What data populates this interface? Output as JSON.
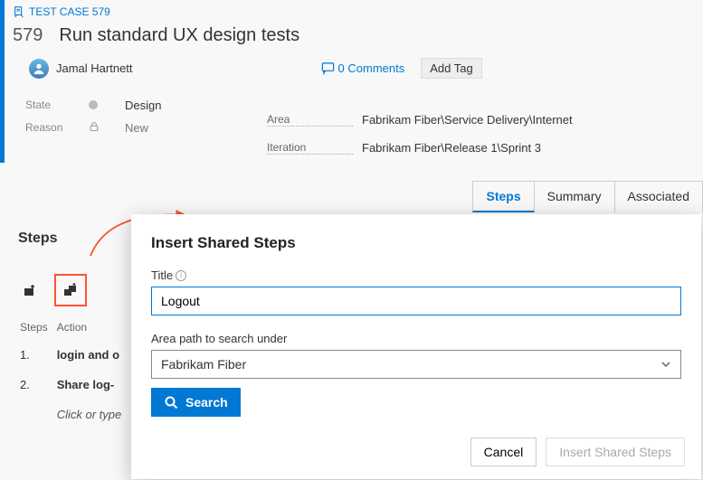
{
  "breadcrumb": {
    "label": "TEST CASE 579"
  },
  "item": {
    "id": "579",
    "title": "Run standard UX design tests"
  },
  "owner": {
    "name": "Jamal Hartnett"
  },
  "comments": {
    "label": "0 Comments"
  },
  "add_tag": {
    "label": "Add Tag"
  },
  "meta": {
    "state_label": "State",
    "state_value": "Design",
    "reason_label": "Reason",
    "reason_value": "New",
    "area_label": "Area",
    "area_value": "Fabrikam Fiber\\Service Delivery\\Internet",
    "iteration_label": "Iteration",
    "iteration_value": "Fabrikam Fiber\\Release 1\\Sprint 3"
  },
  "tabs": {
    "steps": "Steps",
    "summary": "Summary",
    "associated": "Associated"
  },
  "steps": {
    "heading": "Steps",
    "col_steps": "Steps",
    "col_action": "Action",
    "row1_num": "1.",
    "row1_action": "login and o",
    "row2_num": "2.",
    "row2_action": "Share log-",
    "hint": "Click or type"
  },
  "dialog": {
    "title": "Insert Shared Steps",
    "title_field_label": "Title",
    "title_field_value": "Logout",
    "area_field_label": "Area path to search under",
    "area_field_value": "Fabrikam Fiber",
    "search_label": "Search",
    "cancel_label": "Cancel",
    "insert_label": "Insert Shared Steps"
  }
}
